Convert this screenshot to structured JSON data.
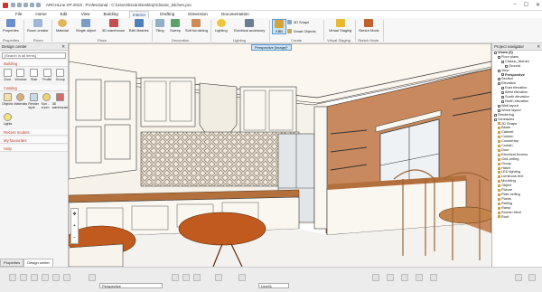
{
  "window": {
    "title": "ARCHLine.XP 2019 . Professional - C:\\Users\\kszan\\Desktop\\Classic_kitchen.pro"
  },
  "menu": {
    "tabs": [
      "File",
      "Home",
      "Edit",
      "View",
      "Building",
      "Interior",
      "Drafting",
      "Dimension",
      "Documentation"
    ],
    "active": "Interior"
  },
  "ribbon": {
    "buttons": {
      "properties": "Properties",
      "room_creator": "Room creator",
      "material": "Material",
      "single_object": "Single object",
      "warehouse_3d": "3D warehouse",
      "bim_libraries": "BIM libraries",
      "tiling": "Tiling",
      "sweep": "Sweep",
      "soft_furnishing": "Soft furnishing",
      "lighting": "Lighting",
      "electrical_accessory": "Electrical accessory",
      "kbb": "KBB",
      "shape_3d": "3D Shape",
      "smart_objects": "Smart Objects",
      "virtual_staging": "Virtual Staging",
      "sketch_mode": "Sketch Mode"
    },
    "groups": [
      "Properties",
      "Room",
      "Place",
      "Decoration",
      "Lighting",
      "Create",
      "Virtual Staging",
      "Sketch Mode"
    ]
  },
  "design_center": {
    "title": "Design center",
    "search_placeholder": "[Search in all items]",
    "building": {
      "header": "Building",
      "items": [
        "Door",
        "Window",
        "Stair",
        "Profile",
        "Group"
      ]
    },
    "catalog": {
      "header": "Catalog",
      "items": [
        "Objects",
        "Materials",
        "Render style",
        "Sun - zoom",
        "3D warehouse"
      ]
    },
    "lights_label": "Lights",
    "sections": [
      "Recent models",
      "My favourites",
      "Help"
    ],
    "tabs": [
      "Properties",
      "Design center"
    ],
    "active_tab": "Design center"
  },
  "viewport": {
    "label": "Perspective [image]*"
  },
  "project_navigator": {
    "title": "Project navigator",
    "items": [
      {
        "label": "Views (6)",
        "bold": true,
        "indent": 0
      },
      {
        "label": "Floor plans",
        "bold": false,
        "indent": 1
      },
      {
        "label": "Classic_kitchen",
        "bold": false,
        "indent": 2
      },
      {
        "label": "Ground",
        "bold": false,
        "indent": 3
      },
      {
        "label": "View",
        "bold": false,
        "indent": 1
      },
      {
        "label": "Perspective",
        "bold": true,
        "indent": 2
      },
      {
        "label": "Section",
        "bold": false,
        "indent": 1
      },
      {
        "label": "Elevation",
        "bold": false,
        "indent": 1
      },
      {
        "label": "East elevation",
        "bold": false,
        "indent": 2
      },
      {
        "label": "West elevation",
        "bold": false,
        "indent": 2
      },
      {
        "label": "South elevation",
        "bold": false,
        "indent": 2
      },
      {
        "label": "North elevation",
        "bold": false,
        "indent": 2
      },
      {
        "label": "Wall layout",
        "bold": false,
        "indent": 1
      },
      {
        "label": "Wood layout",
        "bold": false,
        "indent": 1
      },
      {
        "label": "Rendering",
        "bold": false,
        "indent": 0
      },
      {
        "label": "Schedules",
        "bold": false,
        "indent": 0
      },
      {
        "label": "2D Shape",
        "bold": false,
        "indent": 1
      },
      {
        "label": "Beam",
        "bold": false,
        "indent": 1
      },
      {
        "label": "Cabinet",
        "bold": false,
        "indent": 1
      },
      {
        "label": "Column",
        "bold": false,
        "indent": 1
      },
      {
        "label": "Countertop",
        "bold": false,
        "indent": 1
      },
      {
        "label": "Curtain",
        "bold": false,
        "indent": 1
      },
      {
        "label": "Door",
        "bold": false,
        "indent": 1
      },
      {
        "label": "Electrical Access",
        "bold": false,
        "indent": 1
      },
      {
        "label": "Grid ceiling",
        "bold": false,
        "indent": 1
      },
      {
        "label": "Group",
        "bold": false,
        "indent": 1
      },
      {
        "label": "Hatch",
        "bold": false,
        "indent": 1
      },
      {
        "label": "LED lighting",
        "bold": false,
        "indent": 1
      },
      {
        "label": "Luminous text",
        "bold": false,
        "indent": 1
      },
      {
        "label": "Moulding",
        "bold": false,
        "indent": 1
      },
      {
        "label": "Object",
        "bold": false,
        "indent": 1
      },
      {
        "label": "Picture",
        "bold": false,
        "indent": 1
      },
      {
        "label": "Plain ceiling",
        "bold": false,
        "indent": 1
      },
      {
        "label": "Plants",
        "bold": false,
        "indent": 1
      },
      {
        "label": "Railing",
        "bold": false,
        "indent": 1
      },
      {
        "label": "Ramp",
        "bold": false,
        "indent": 1
      },
      {
        "label": "Roman blind",
        "bold": false,
        "indent": 1
      },
      {
        "label": "Roof",
        "bold": false,
        "indent": 1
      }
    ]
  },
  "statusbar": {
    "view_field": "Perspective",
    "layer_field": "Line01"
  },
  "colors": {
    "wall": "#c8895e",
    "stool": "#c05a1e",
    "countertop": "#b3703c",
    "accent": "#1a4d8f"
  }
}
